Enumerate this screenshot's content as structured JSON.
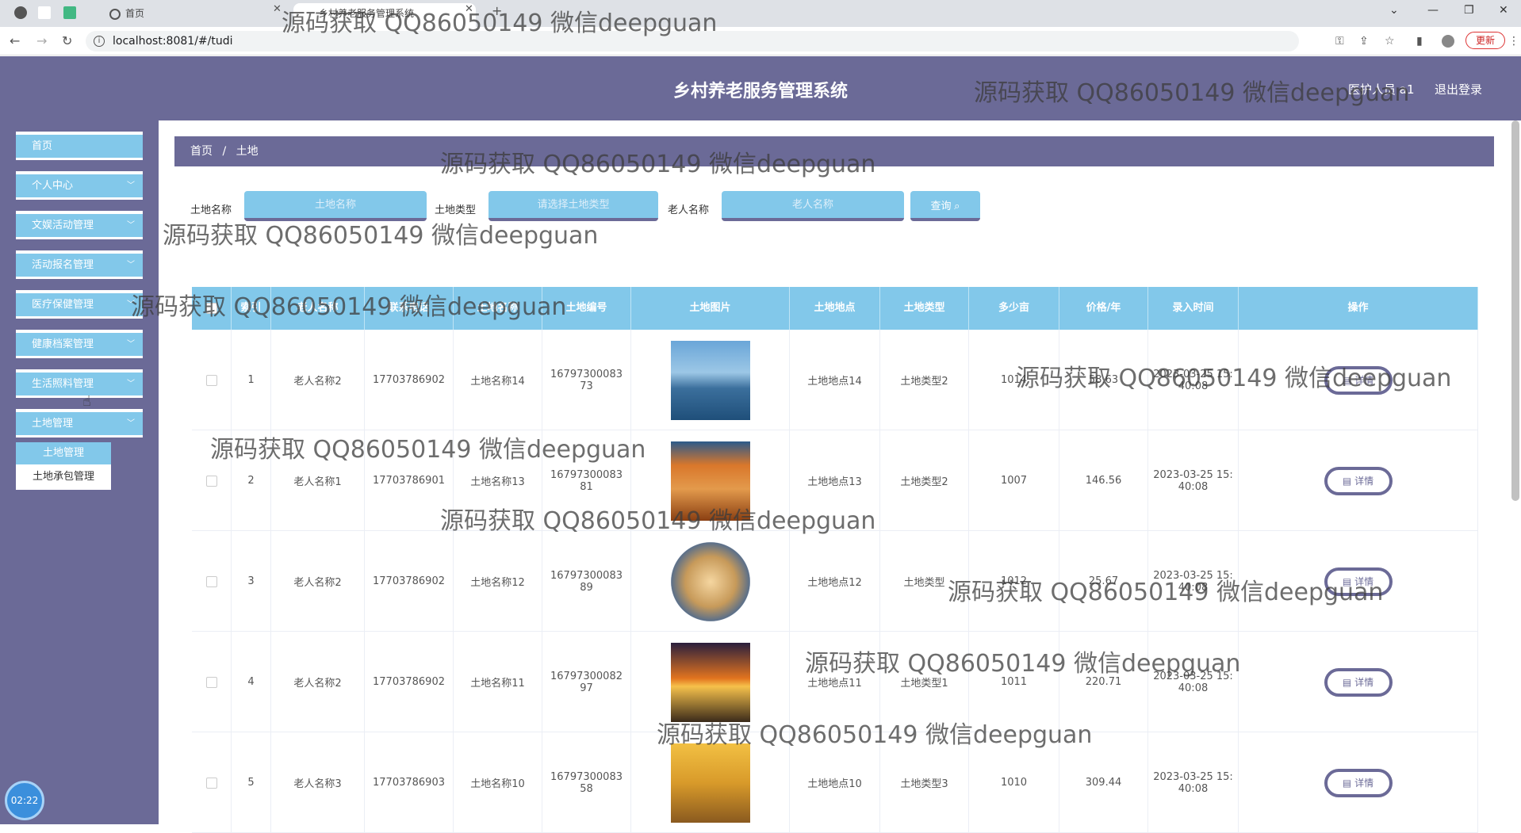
{
  "browser": {
    "tabs": [
      {
        "label": "首页"
      },
      {
        "label": "乡村养老服务管理系统"
      }
    ],
    "url": "localhost:8081/#/tudi",
    "update_label": "更新"
  },
  "header": {
    "title": "乡村养老服务管理系统",
    "user_label": "医护人员 a1",
    "logout_label": "退出登录"
  },
  "sidebar": {
    "items": [
      {
        "label": "首页"
      },
      {
        "label": "个人中心"
      },
      {
        "label": "文娱活动管理"
      },
      {
        "label": "活动报名管理"
      },
      {
        "label": "医疗保健管理"
      },
      {
        "label": "健康档案管理"
      },
      {
        "label": "生活照料管理"
      },
      {
        "label": "土地管理"
      }
    ],
    "submenu": [
      {
        "label": "土地管理"
      },
      {
        "label": "土地承包管理"
      }
    ],
    "timer": "02:22"
  },
  "breadcrumb": {
    "home": "首页",
    "separator": "/",
    "current": "土地"
  },
  "search": {
    "land_name_label": "土地名称",
    "land_name_placeholder": "土地名称",
    "land_type_label": "土地类型",
    "land_type_placeholder": "请选择土地类型",
    "elder_name_label": "老人名称",
    "elder_name_placeholder": "老人名称",
    "query_label": "查询"
  },
  "table": {
    "headers": [
      "",
      "索引",
      "老人名称",
      "联系电话",
      "土地名称",
      "土地编号",
      "土地图片",
      "土地地点",
      "土地类型",
      "多少亩",
      "价格/年",
      "录入时间",
      "操作"
    ],
    "detail_label": "详情",
    "rows": [
      {
        "index": "1",
        "elder": "老人名称2",
        "phone": "17703786902",
        "name": "土地名称14",
        "code": "1679730008373",
        "location": "土地地点14",
        "type": "土地类型2",
        "mu": "1014",
        "price": "58.63",
        "time": "2023-03-25 15:40:08",
        "img": "lake"
      },
      {
        "index": "2",
        "elder": "老人名称1",
        "phone": "17703786901",
        "name": "土地名称13",
        "code": "1679730008381",
        "location": "土地地点13",
        "type": "土地类型2",
        "mu": "1007",
        "price": "146.56",
        "time": "2023-03-25 15:40:08",
        "img": "rock"
      },
      {
        "index": "3",
        "elder": "老人名称2",
        "phone": "17703786902",
        "name": "土地名称12",
        "code": "1679730008389",
        "location": "土地地点12",
        "type": "土地类型",
        "mu": "1012",
        "price": "25.67",
        "time": "2023-03-25 15:40:08",
        "img": "sphere"
      },
      {
        "index": "4",
        "elder": "老人名称2",
        "phone": "17703786902",
        "name": "土地名称11",
        "code": "1679730008297",
        "location": "土地地点11",
        "type": "土地类型1",
        "mu": "1011",
        "price": "220.71",
        "time": "2023-03-25 15:40:08",
        "img": "sunset"
      },
      {
        "index": "5",
        "elder": "老人名称3",
        "phone": "17703786903",
        "name": "土地名称10",
        "code": "1679730008358",
        "location": "土地地点10",
        "type": "土地类型3",
        "mu": "1010",
        "price": "309.44",
        "time": "2023-03-25 15:40:08",
        "img": "autumn"
      }
    ]
  },
  "watermark": "源码获取 QQ86050149 微信deepguan",
  "colors": {
    "header": "#6b6a97",
    "accent": "#82c8ea"
  }
}
